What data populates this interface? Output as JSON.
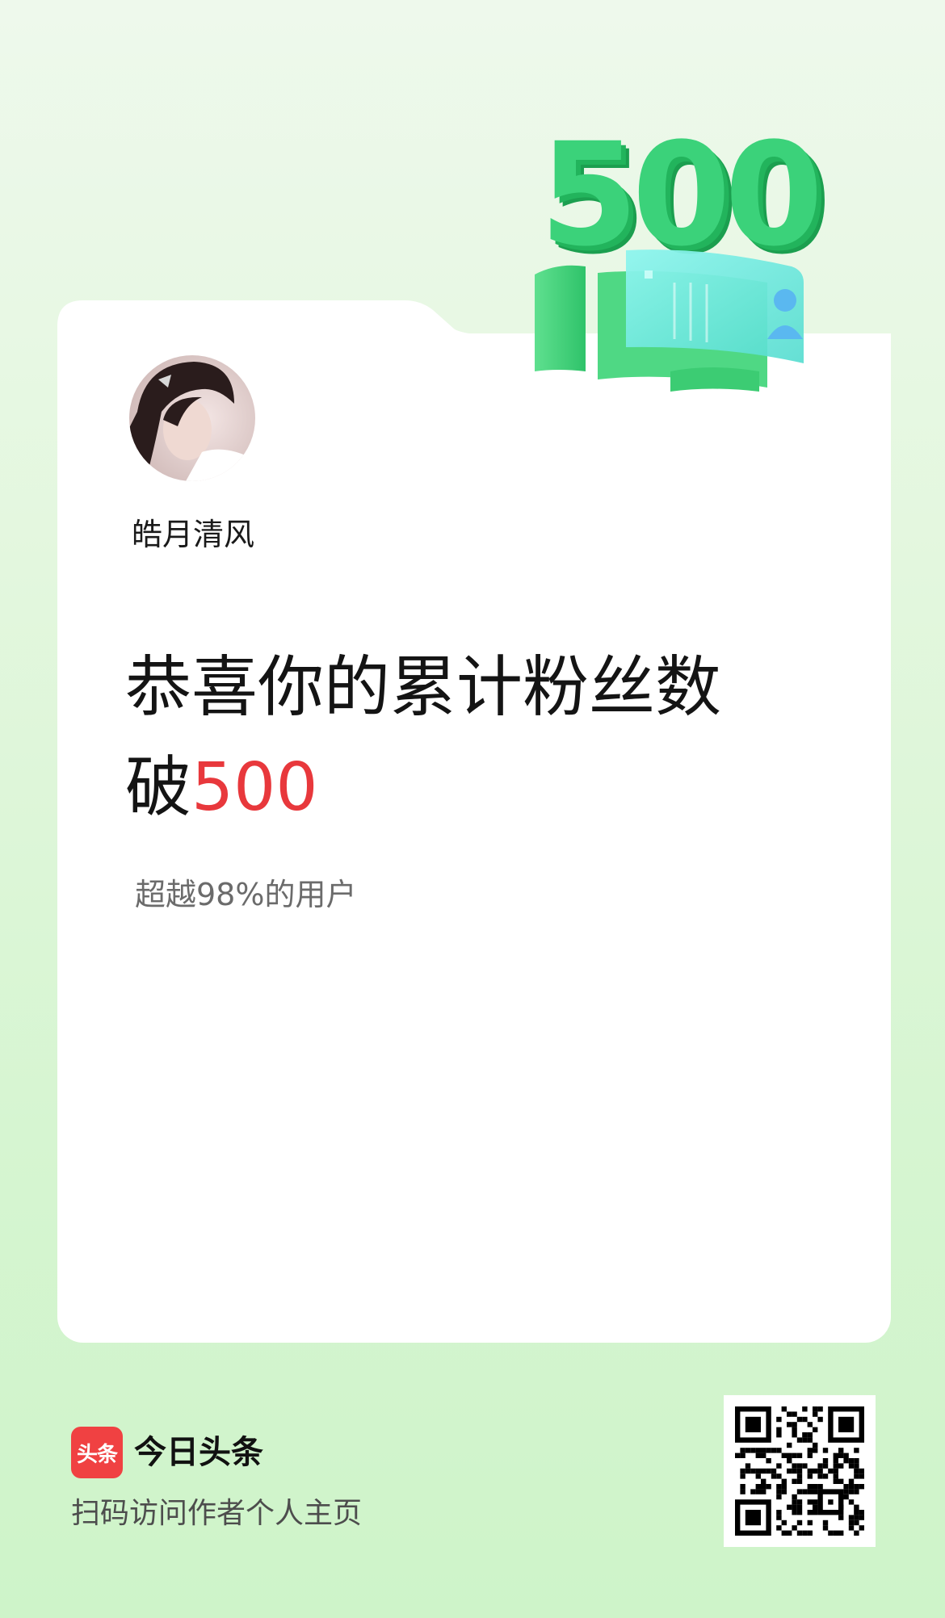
{
  "profile": {
    "username": "皓月清风",
    "avatar_alt": "avatar"
  },
  "milestone": {
    "badge_number": "500",
    "headline_prefix": "恭喜你的累计粉丝数",
    "headline_break": "破",
    "headline_number": "500",
    "subtitle": "超越98%的用户"
  },
  "footer": {
    "logo_text": "头条",
    "brand_name": "今日头条",
    "caption": "扫码访问作者个人主页",
    "qr_icon": "qr-code-icon"
  },
  "colors": {
    "accent_red": "#e8383c",
    "badge_green": "#3bd27a",
    "brand_red": "#f04142"
  }
}
